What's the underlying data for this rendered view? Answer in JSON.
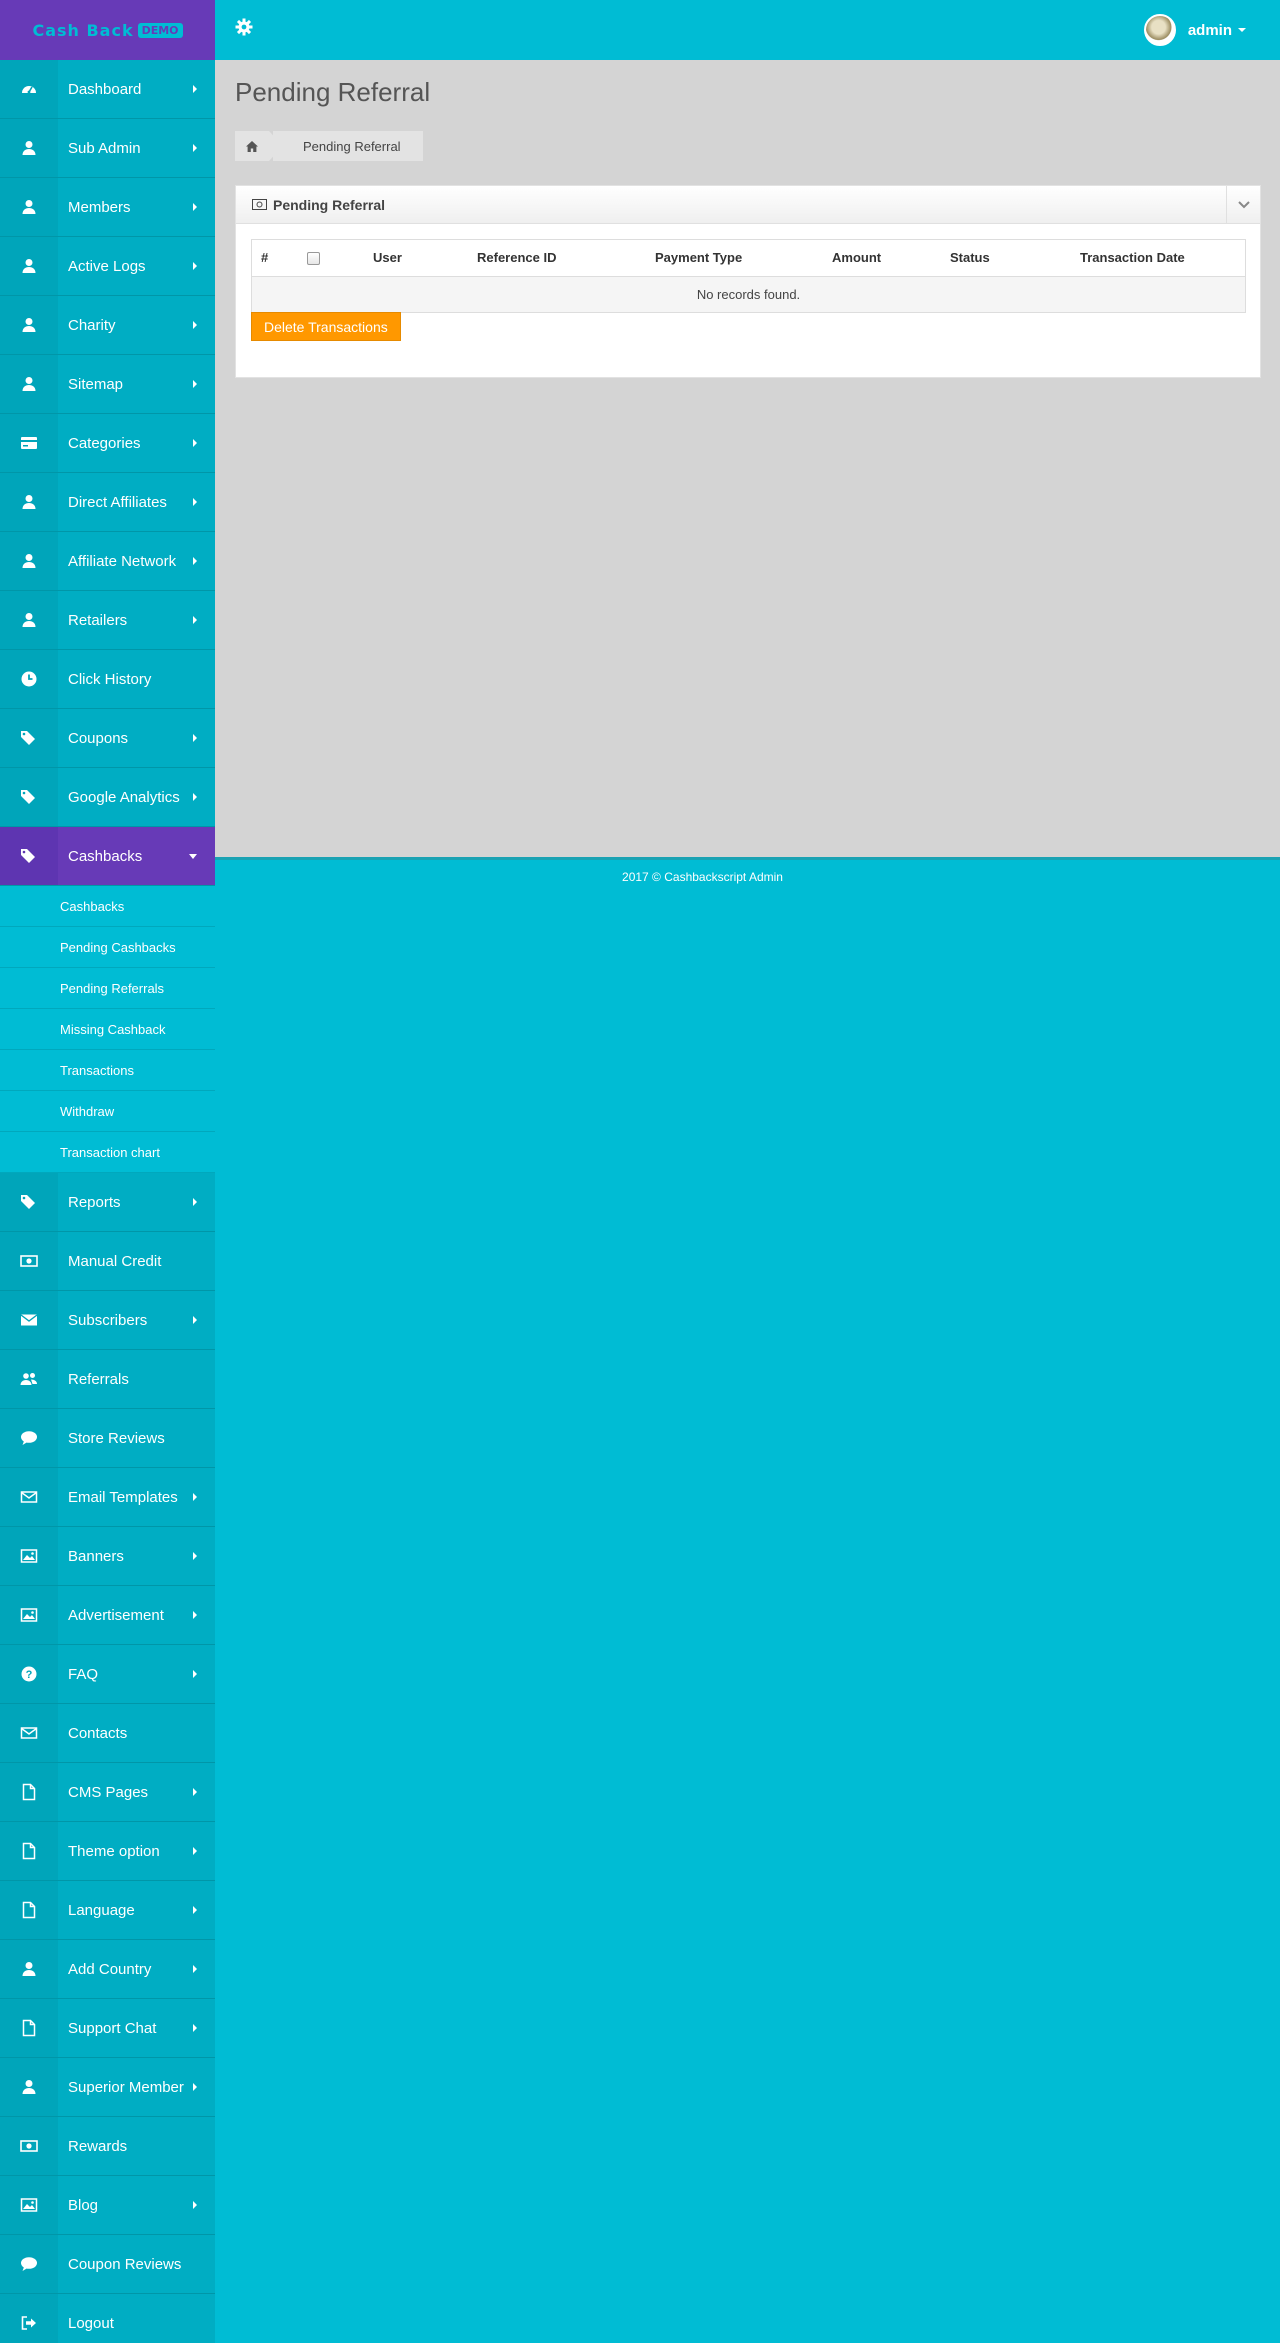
{
  "brand": {
    "name": "Cash Back",
    "badge": "DEMO"
  },
  "header": {
    "user_name": "admin"
  },
  "sidebar": {
    "items_top": [
      {
        "label": "Dashboard",
        "icon": "dashboard-icon",
        "caret": true
      },
      {
        "label": "Sub Admin",
        "icon": "user-icon",
        "caret": true
      },
      {
        "label": "Members",
        "icon": "user-icon",
        "caret": true
      },
      {
        "label": "Active Logs",
        "icon": "user-icon",
        "caret": true
      },
      {
        "label": "Charity",
        "icon": "user-icon",
        "caret": true
      },
      {
        "label": "Sitemap",
        "icon": "user-icon",
        "caret": true
      },
      {
        "label": "Categories",
        "icon": "credit-card-icon",
        "caret": true
      },
      {
        "label": "Direct Affiliates",
        "icon": "user-icon",
        "caret": true
      },
      {
        "label": "Affiliate Network",
        "icon": "user-icon",
        "caret": true
      },
      {
        "label": "Retailers",
        "icon": "user-icon",
        "caret": true
      },
      {
        "label": "Click History",
        "icon": "clock-icon",
        "caret": false
      },
      {
        "label": "Coupons",
        "icon": "tags-icon",
        "caret": true
      },
      {
        "label": "Google Analytics",
        "icon": "tags-icon",
        "caret": true
      }
    ],
    "active_item": {
      "label": "Cashbacks",
      "icon": "tags-icon"
    },
    "sub_items": [
      "Cashbacks",
      "Pending Cashbacks",
      "Pending Referrals",
      "Missing Cashback",
      "Transactions",
      "Withdraw",
      "Transaction chart"
    ],
    "items_bottom": [
      {
        "label": "Reports",
        "icon": "tag-icon",
        "caret": true
      },
      {
        "label": "Manual Credit",
        "icon": "money-icon",
        "caret": false
      },
      {
        "label": "Subscribers",
        "icon": "envelope-icon",
        "caret": true
      },
      {
        "label": "Referrals",
        "icon": "users-icon",
        "caret": false
      },
      {
        "label": "Store Reviews",
        "icon": "comment-icon",
        "caret": false
      },
      {
        "label": "Email Templates",
        "icon": "envelope-outline-icon",
        "caret": true
      },
      {
        "label": "Banners",
        "icon": "image-icon",
        "caret": true
      },
      {
        "label": "Advertisement",
        "icon": "image-icon",
        "caret": true
      },
      {
        "label": "FAQ",
        "icon": "question-icon",
        "caret": true
      },
      {
        "label": "Contacts",
        "icon": "envelope-outline-icon",
        "caret": false
      },
      {
        "label": "CMS Pages",
        "icon": "file-icon",
        "caret": true
      },
      {
        "label": "Theme option",
        "icon": "file-icon",
        "caret": true
      },
      {
        "label": "Language",
        "icon": "file-icon",
        "caret": true
      },
      {
        "label": "Add Country",
        "icon": "user-icon",
        "caret": true
      },
      {
        "label": "Support Chat",
        "icon": "file-icon",
        "caret": true
      },
      {
        "label": "Superior Member",
        "icon": "user-icon",
        "caret": true
      },
      {
        "label": "Rewards",
        "icon": "money-icon",
        "caret": false
      },
      {
        "label": "Blog",
        "icon": "image-icon",
        "caret": true
      },
      {
        "label": "Coupon Reviews",
        "icon": "comment-icon",
        "caret": false
      },
      {
        "label": "Logout",
        "icon": "sign-out-icon",
        "caret": false
      }
    ]
  },
  "page": {
    "title": "Pending Referral",
    "breadcrumb": {
      "home_icon": "home-icon",
      "current": "Pending Referral"
    },
    "panel_title": "Pending Referral",
    "table": {
      "columns": [
        "#",
        "",
        "User",
        "Reference ID",
        "Payment Type",
        "Amount",
        "Status",
        "Transaction Date"
      ],
      "empty_message": "No records found."
    },
    "delete_button": "Delete Transactions"
  },
  "footer": {
    "text": "2017 © Cashbackscript Admin"
  },
  "colors": {
    "primary": "#00bcd4",
    "sidebar": "#00adc3",
    "accent": "#673ab7",
    "button": "#ff9800",
    "content_bg": "#d4d4d4"
  }
}
